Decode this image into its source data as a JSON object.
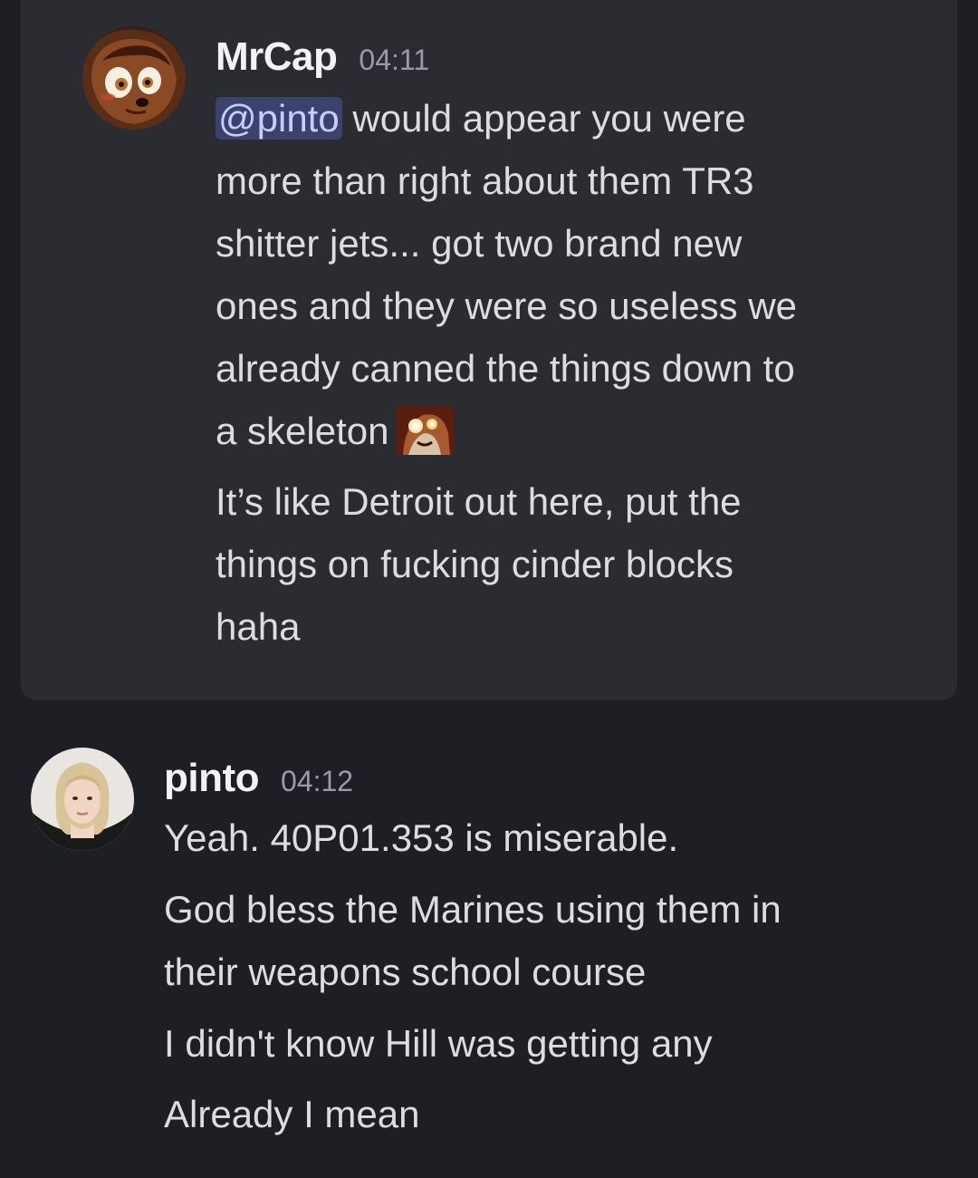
{
  "messages": [
    {
      "author": "MrCap",
      "time": "04:11",
      "avatar_icon": "cartoon-character-avatar",
      "highlighted": true,
      "mention": "@pinto",
      "lines": [
        " would appear you were",
        "more than right about them TR3",
        "shitter jets... got two brand new",
        "ones and they were so useless we",
        "already canned the things down to",
        "a skeleton"
      ],
      "emoji": "glowing-eyes-emoji",
      "followups": [
        "It’s like Detroit out here, put the",
        "things on fucking cinder blocks",
        "haha"
      ]
    },
    {
      "author": "pinto",
      "time": "04:12",
      "avatar_icon": "woman-portrait-avatar",
      "lines": [
        "Yeah. 40P01.353 is miserable.",
        "God bless the Marines using them in",
        "their weapons school course",
        "I didn't know Hill was getting any",
        "Already I mean"
      ]
    }
  ],
  "colors": {
    "background": "#1e1f24",
    "highlight_background": "#2b2c32",
    "mention_background": "#3c4270",
    "mention_text": "#c9cdfb",
    "username": "#f2f3f5",
    "timestamp": "#9a9ca4",
    "message_text": "#dcdde1"
  }
}
